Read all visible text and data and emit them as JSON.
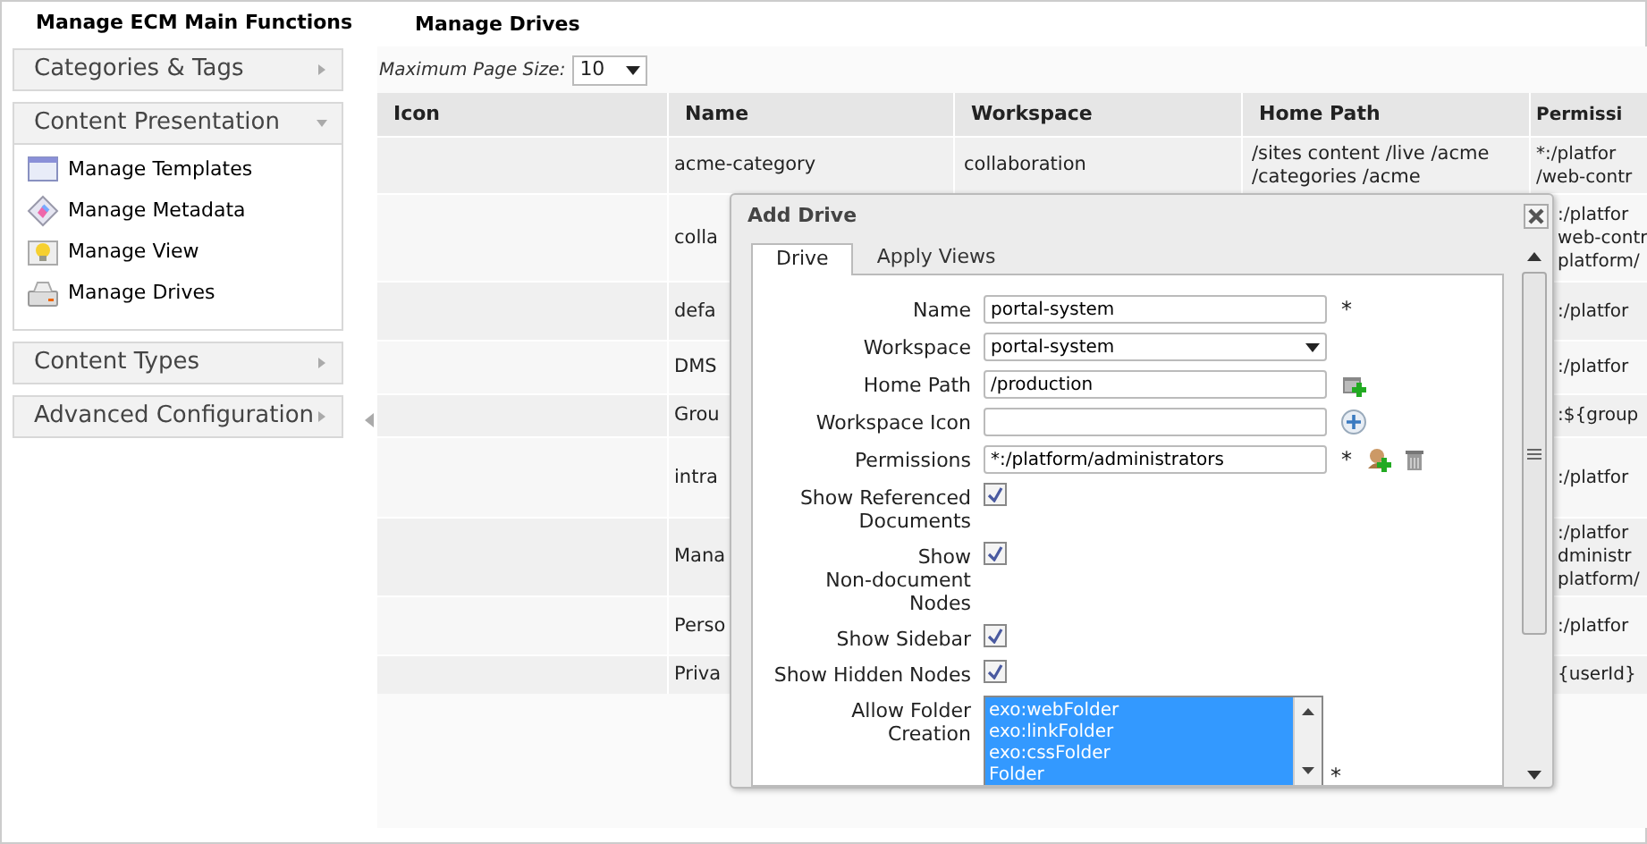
{
  "sidebar": {
    "title": "Manage ECM Main Functions",
    "sections": [
      {
        "label": "Categories & Tags",
        "expanded": false
      },
      {
        "label": "Content Presentation",
        "expanded": true,
        "items": [
          {
            "label": "Manage Templates"
          },
          {
            "label": "Manage Metadata"
          },
          {
            "label": "Manage View"
          },
          {
            "label": "Manage Drives"
          }
        ]
      },
      {
        "label": "Content Types",
        "expanded": false
      },
      {
        "label": "Advanced Configuration",
        "expanded": false
      }
    ]
  },
  "main": {
    "title": "Manage Drives",
    "page_size": {
      "label": "Maximum Page Size:",
      "value": "10"
    },
    "table": {
      "columns": [
        "Icon",
        "Name",
        "Workspace",
        "Home Path",
        "Permissi"
      ],
      "rows": [
        {
          "name": "acme-category",
          "workspace": "collaboration",
          "home_path": "/sites content /live /acme\n/categories /acme",
          "permissions": "*:/platfor\n/web-contr"
        },
        {
          "name": "colla",
          "permissions": ":/platfor\nweb-contr\nplatform/"
        },
        {
          "name": "defa",
          "permissions": ":/platfor"
        },
        {
          "name": "DMS",
          "permissions": ":/platfor"
        },
        {
          "name": "Grou",
          "permissions": ":${group"
        },
        {
          "name": "intra",
          "permissions": ":/platfor"
        },
        {
          "name": "Mana",
          "permissions": ":/platfor\ndministr\nplatform/"
        },
        {
          "name": "Perso",
          "permissions": ":/platfor"
        },
        {
          "name": "Priva",
          "permissions": "{userId}"
        }
      ]
    }
  },
  "dialog": {
    "title": "Add Drive",
    "tabs": [
      {
        "label": "Drive",
        "selected": true
      },
      {
        "label": "Apply Views",
        "selected": false
      }
    ],
    "fields": [
      {
        "kind": "text",
        "label": "Name",
        "value": "portal-system",
        "required_mark": "*"
      },
      {
        "kind": "select",
        "label": "Workspace",
        "value": "portal-system"
      },
      {
        "kind": "text",
        "label": "Home Path",
        "value": "/production"
      },
      {
        "kind": "text",
        "label": "Workspace Icon"
      },
      {
        "kind": "text",
        "label": "Permissions",
        "value": "*:/platform/administrators",
        "required_mark": "*"
      },
      {
        "kind": "checkbox",
        "label": "Show Referenced\nDocuments",
        "checked": true
      },
      {
        "kind": "checkbox",
        "label": "Show\nNon-document\nNodes",
        "checked": true
      },
      {
        "kind": "checkbox",
        "label": "Show Sidebar",
        "checked": true
      },
      {
        "kind": "checkbox",
        "label": "Show Hidden Nodes",
        "checked": true
      },
      {
        "kind": "listbox",
        "label": "Allow Folder\nCreation",
        "options": [
          {
            "label": "exo:webFolder",
            "selected": true
          },
          {
            "label": "exo:linkFolder",
            "selected": true
          },
          {
            "label": "exo:cssFolder",
            "selected": true
          },
          {
            "label": "Folder",
            "selected": true
          }
        ],
        "required_mark": "*"
      }
    ]
  }
}
